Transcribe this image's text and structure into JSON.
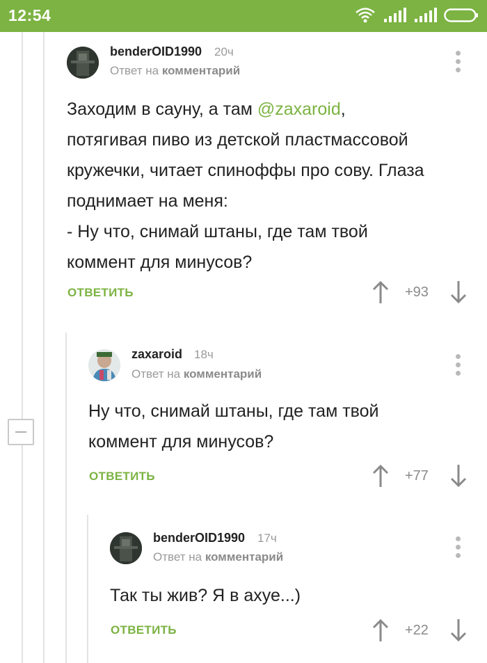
{
  "status_bar": {
    "time": "12:54"
  },
  "comments": [
    {
      "username": "benderOID1990",
      "time": "20ч",
      "reply_prefix": "Ответ на",
      "reply_target": "комментарий",
      "text_before": "Заходим в сауну, а там ",
      "mention": "@zaxaroid",
      "text_after": ",\nпотягивая пиво из детской пластмассовой\nкружечки, читает спиноффы про сову. Глаза\nподнимает на меня:\n- Ну что, снимай штаны, где там твой\nкоммент для минусов?",
      "reply_label": "ОТВЕТИТЬ",
      "score": "+93"
    },
    {
      "username": "zaxaroid",
      "time": "18ч",
      "reply_prefix": "Ответ на",
      "reply_target": "комментарий",
      "text": "Ну что, снимай штаны, где там твой\nкоммент для минусов?",
      "reply_label": "ОТВЕТИТЬ",
      "score": "+77"
    },
    {
      "username": "benderOID1990",
      "time": "17ч",
      "reply_prefix": "Ответ на",
      "reply_target": "комментарий",
      "text": "Так ты жив? Я в ахуе...)",
      "reply_label": "ОТВЕТИТЬ",
      "score": "+22"
    }
  ],
  "colors": {
    "accent": "#7cb342",
    "status_bar": "#7cb342",
    "muted": "#9a9a9a"
  }
}
